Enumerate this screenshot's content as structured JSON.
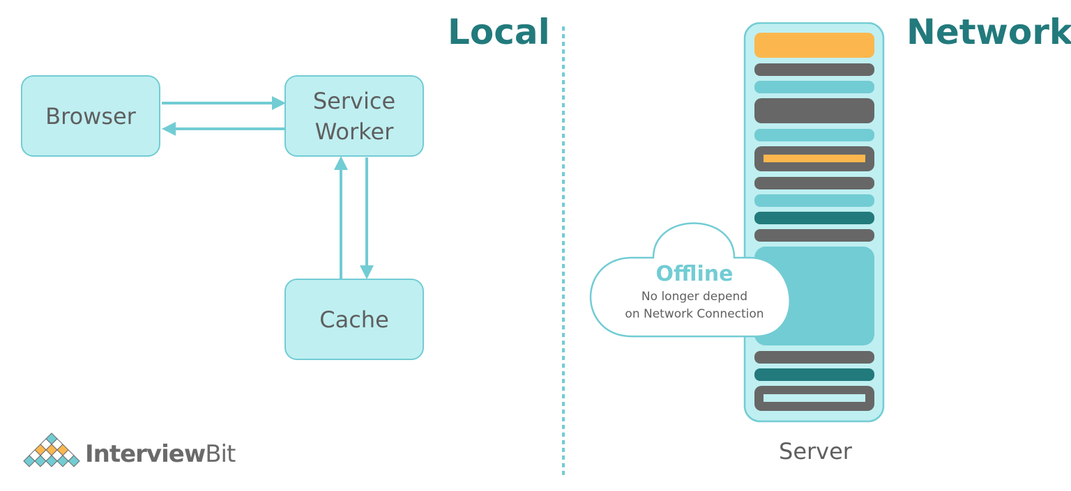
{
  "headings": {
    "local": "Local",
    "network": "Network"
  },
  "nodes": {
    "browser": "Browser",
    "service_worker_line1": "Service",
    "service_worker_line2": "Worker",
    "cache": "Cache"
  },
  "offline_cloud": {
    "title": "Offline",
    "line1": "No longer depend",
    "line2": "on Network Connection"
  },
  "server": {
    "label": "Server"
  },
  "logo": {
    "bold": "Interview",
    "regular": "Bit"
  },
  "colors": {
    "node_fill": "#bfeff1",
    "node_border": "#72ccd4",
    "heading": "#227a7c",
    "accent_orange": "#fbb74e",
    "dark_gray": "#676767",
    "teal_dark": "#227a7c",
    "teal_light": "#72ccd4"
  }
}
